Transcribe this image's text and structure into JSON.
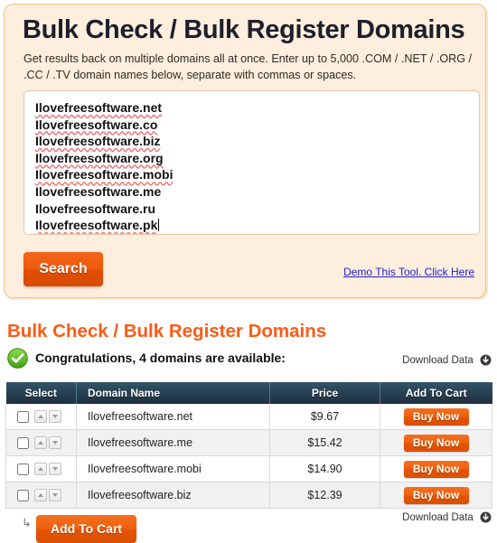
{
  "search_panel": {
    "title": "Bulk Check / Bulk Register Domains",
    "description": "Get results back on multiple domains all at once. Enter up to 5,000 .COM / .NET / .ORG / .CC / .TV domain names below, separate with commas or spaces.",
    "textarea": {
      "lines": [
        {
          "text": "Ilovefreesoftware.net",
          "misspelled": true
        },
        {
          "text": "Ilovefreesoftware.co",
          "misspelled": true
        },
        {
          "text": "Ilovefreesoftware.biz",
          "misspelled": true
        },
        {
          "text": "Ilovefreesoftware.org",
          "misspelled": true
        },
        {
          "text": "Ilovefreesoftware.mobi",
          "misspelled": true
        },
        {
          "text": "Ilovefreesoftware.me",
          "misspelled": false
        },
        {
          "text": "Ilovefreesoftware.ru",
          "misspelled": false
        },
        {
          "text": "Ilovefreesoftware.pk",
          "misspelled": true
        }
      ],
      "placeholder": ""
    },
    "search_button": "Search",
    "demo_link": "Demo This Tool. Click Here"
  },
  "results": {
    "title": "Bulk Check / Bulk Register Domains",
    "status_icon": "green-check-icon",
    "status_text": "Congratulations, 4 domains are available:",
    "download_data_label": "Download Data",
    "download_icon": "download-circle-icon",
    "table": {
      "columns": [
        "Select",
        "Domain Name",
        "Price",
        "Add To Cart"
      ],
      "rows": [
        {
          "selected": false,
          "domain": "Ilovefreesoftware.net",
          "price": "$9.67",
          "cart_label": "Buy Now"
        },
        {
          "selected": false,
          "domain": "Ilovefreesoftware.me",
          "price": "$15.42",
          "cart_label": "Buy Now"
        },
        {
          "selected": false,
          "domain": "Ilovefreesoftware.mobi",
          "price": "$14.90",
          "cart_label": "Buy Now"
        },
        {
          "selected": false,
          "domain": "Ilovefreesoftware.biz",
          "price": "$12.39",
          "cart_label": "Buy Now"
        }
      ]
    },
    "footer": {
      "sub_arrow_glyph": "↳",
      "add_to_cart_label": "Add To Cart",
      "download_data_label": "Download Data"
    }
  },
  "colors": {
    "panel_bg": "#fdeedd",
    "panel_border": "#f0c48a",
    "orange_accent": "#ff5a14",
    "button_orange": "#ed5a0c",
    "table_header": "#2a4457",
    "link_blue": "#2222cc",
    "status_green": "#5cba2c"
  }
}
